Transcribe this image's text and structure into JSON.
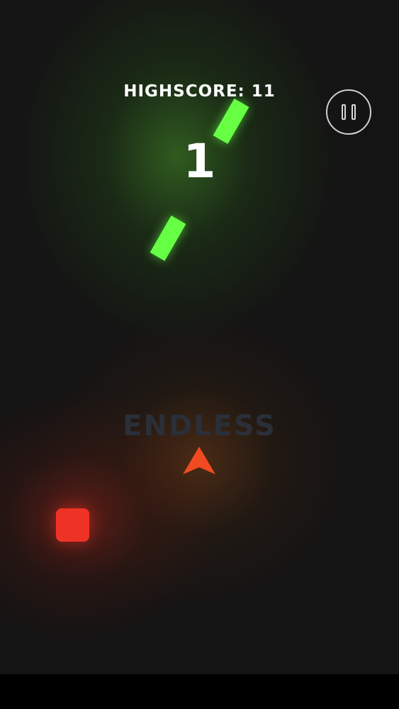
{
  "hud": {
    "highscore_text": "HIGHSCORE: 11",
    "score": "1",
    "mode": "ENDLESS"
  },
  "controls": {
    "pause_icon": "pause-icon"
  },
  "colors": {
    "green_obstacle": "#66ff44",
    "red_obstacle": "#ee3326",
    "player": "#f04a23",
    "mode_text": "#2a2f38"
  }
}
